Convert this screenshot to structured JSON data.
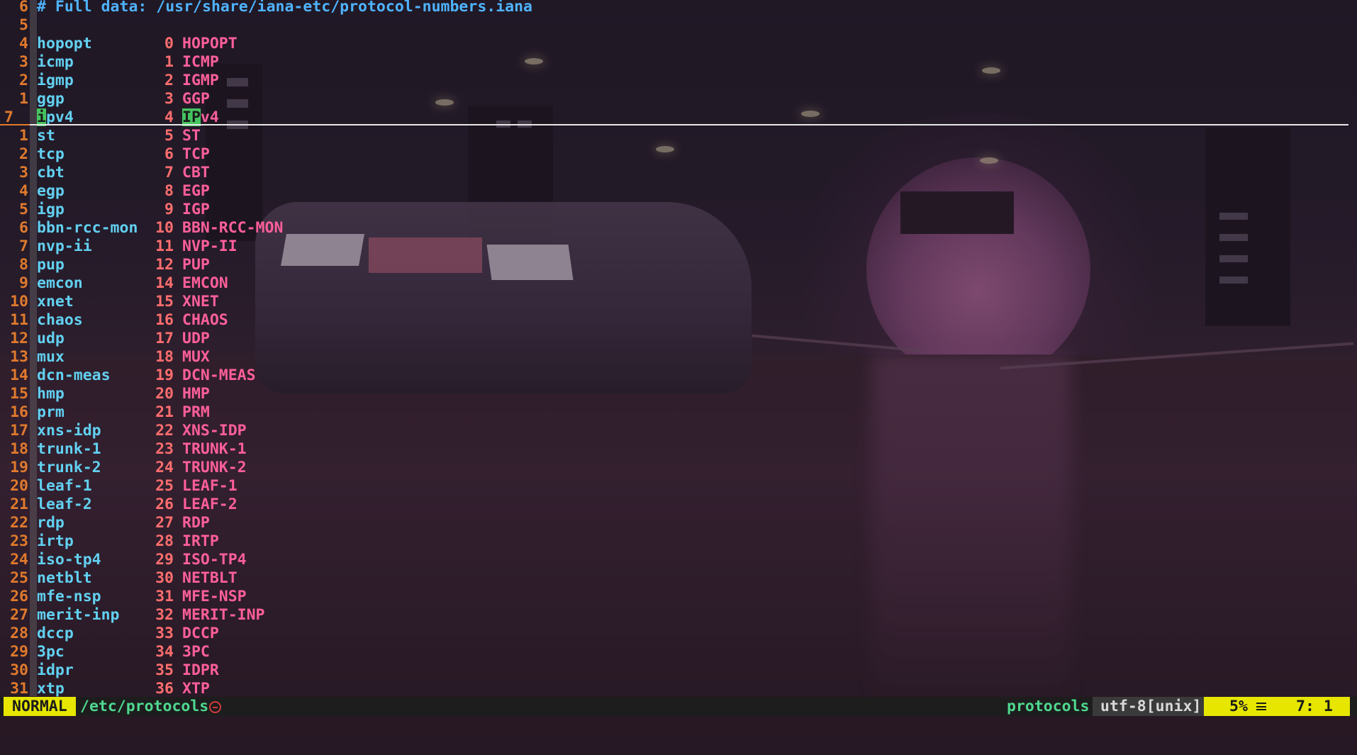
{
  "editor": {
    "header_line": {
      "lnum": "6",
      "text": "# Full data: /usr/share/iana-etc/protocol-numbers.iana"
    },
    "blank_line": {
      "lnum": "5"
    },
    "rows": [
      {
        "lnum": "4",
        "name": "hopopt",
        "num": "0",
        "alias": "HOPOPT"
      },
      {
        "lnum": "3",
        "name": "icmp",
        "num": "1",
        "alias": "ICMP"
      },
      {
        "lnum": "2",
        "name": "igmp",
        "num": "2",
        "alias": "IGMP"
      },
      {
        "lnum": "1",
        "name": "ggp",
        "num": "3",
        "alias": "GGP"
      },
      {
        "lnum": "7",
        "name": "ipv4",
        "num": "4",
        "alias": "IPv4",
        "current": true
      },
      {
        "lnum": "1",
        "name": "st",
        "num": "5",
        "alias": "ST"
      },
      {
        "lnum": "2",
        "name": "tcp",
        "num": "6",
        "alias": "TCP"
      },
      {
        "lnum": "3",
        "name": "cbt",
        "num": "7",
        "alias": "CBT"
      },
      {
        "lnum": "4",
        "name": "egp",
        "num": "8",
        "alias": "EGP"
      },
      {
        "lnum": "5",
        "name": "igp",
        "num": "9",
        "alias": "IGP"
      },
      {
        "lnum": "6",
        "name": "bbn-rcc-mon",
        "num": "10",
        "alias": "BBN-RCC-MON"
      },
      {
        "lnum": "7",
        "name": "nvp-ii",
        "num": "11",
        "alias": "NVP-II"
      },
      {
        "lnum": "8",
        "name": "pup",
        "num": "12",
        "alias": "PUP"
      },
      {
        "lnum": "9",
        "name": "emcon",
        "num": "14",
        "alias": "EMCON"
      },
      {
        "lnum": "10",
        "name": "xnet",
        "num": "15",
        "alias": "XNET"
      },
      {
        "lnum": "11",
        "name": "chaos",
        "num": "16",
        "alias": "CHAOS"
      },
      {
        "lnum": "12",
        "name": "udp",
        "num": "17",
        "alias": "UDP"
      },
      {
        "lnum": "13",
        "name": "mux",
        "num": "18",
        "alias": "MUX"
      },
      {
        "lnum": "14",
        "name": "dcn-meas",
        "num": "19",
        "alias": "DCN-MEAS"
      },
      {
        "lnum": "15",
        "name": "hmp",
        "num": "20",
        "alias": "HMP"
      },
      {
        "lnum": "16",
        "name": "prm",
        "num": "21",
        "alias": "PRM"
      },
      {
        "lnum": "17",
        "name": "xns-idp",
        "num": "22",
        "alias": "XNS-IDP"
      },
      {
        "lnum": "18",
        "name": "trunk-1",
        "num": "23",
        "alias": "TRUNK-1"
      },
      {
        "lnum": "19",
        "name": "trunk-2",
        "num": "24",
        "alias": "TRUNK-2"
      },
      {
        "lnum": "20",
        "name": "leaf-1",
        "num": "25",
        "alias": "LEAF-1"
      },
      {
        "lnum": "21",
        "name": "leaf-2",
        "num": "26",
        "alias": "LEAF-2"
      },
      {
        "lnum": "22",
        "name": "rdp",
        "num": "27",
        "alias": "RDP"
      },
      {
        "lnum": "23",
        "name": "irtp",
        "num": "28",
        "alias": "IRTP"
      },
      {
        "lnum": "24",
        "name": "iso-tp4",
        "num": "29",
        "alias": "ISO-TP4"
      },
      {
        "lnum": "25",
        "name": "netblt",
        "num": "30",
        "alias": "NETBLT"
      },
      {
        "lnum": "26",
        "name": "mfe-nsp",
        "num": "31",
        "alias": "MFE-NSP"
      },
      {
        "lnum": "27",
        "name": "merit-inp",
        "num": "32",
        "alias": "MERIT-INP"
      },
      {
        "lnum": "28",
        "name": "dccp",
        "num": "33",
        "alias": "DCCP"
      },
      {
        "lnum": "29",
        "name": "3pc",
        "num": "34",
        "alias": "3PC"
      },
      {
        "lnum": "30",
        "name": "idpr",
        "num": "35",
        "alias": "IDPR"
      },
      {
        "lnum": "31",
        "name": "xtp",
        "num": "36",
        "alias": "XTP"
      }
    ]
  },
  "statusline": {
    "mode": "NORMAL",
    "file_path": "/etc/protocols",
    "readonly_icon": "minus-circle-icon",
    "filetype": "protocols",
    "encoding": "utf-8[unix]",
    "percent": "5%",
    "percent_icon": "hamburger-icon",
    "line_col": "7:  1"
  },
  "colors": {
    "mode_bg": "#e6e600",
    "line_number": "#e07a2d",
    "protocol_name": "#62d0f0",
    "protocol_number": "#ff6e6e",
    "protocol_alias": "#ff5f9a",
    "comment": "#4fb3ff",
    "path": "#4fd890",
    "search_highlight": "#45c45f"
  }
}
